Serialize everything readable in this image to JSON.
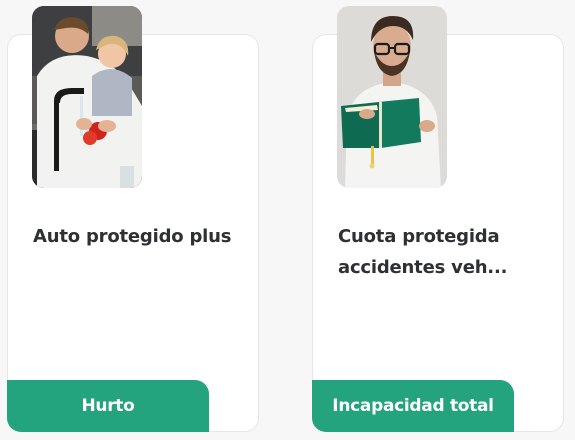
{
  "cards": [
    {
      "title": "Auto protegido plus",
      "tag": "Hurto",
      "image": "father-and-daughter-washing-vegetables-photo"
    },
    {
      "title": "Cuota protegida accidentes veh...",
      "tag": "Incapacidad total",
      "image": "man-with-glasses-reading-book-photo"
    }
  ],
  "colors": {
    "accent": "#23a37e",
    "title_text": "#2f3033",
    "card_bg": "#ffffff",
    "page_bg": "#f7f7f7"
  }
}
